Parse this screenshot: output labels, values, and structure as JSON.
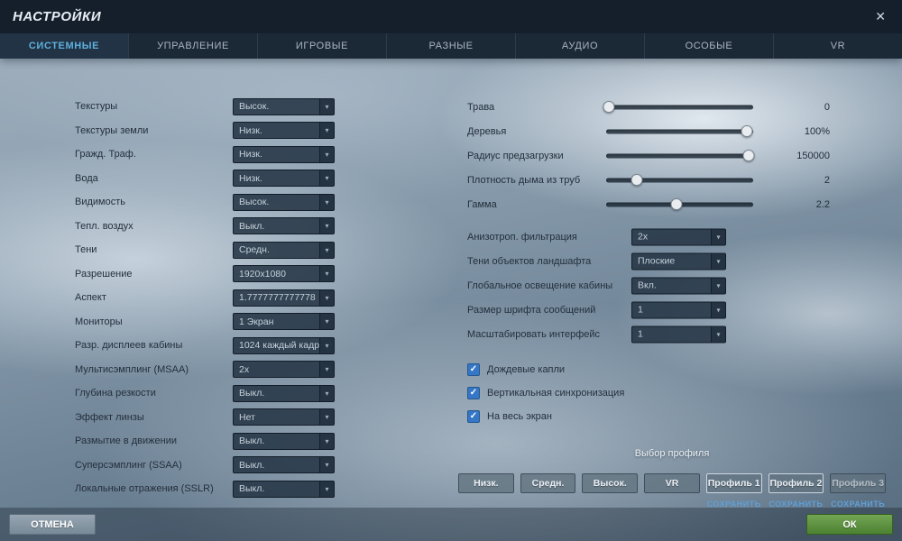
{
  "header": {
    "title": "НАСТРОЙКИ"
  },
  "icons": {
    "close": "✕",
    "chevron_down": "▾",
    "check": "✓"
  },
  "tabs": [
    {
      "label": "СИСТЕМНЫЕ",
      "cls": "active"
    },
    {
      "label": "УПРАВЛЕНИЕ",
      "cls": ""
    },
    {
      "label": "ИГРОВЫЕ",
      "cls": ""
    },
    {
      "label": "РАЗНЫЕ",
      "cls": ""
    },
    {
      "label": "АУДИО",
      "cls": ""
    },
    {
      "label": "ОСОБЫЕ",
      "cls": ""
    },
    {
      "label": "VR",
      "cls": ""
    }
  ],
  "left_settings": [
    {
      "label": "Текстуры",
      "value": "Высок."
    },
    {
      "label": "Текстуры земли",
      "value": "Низк."
    },
    {
      "label": "Гражд. Траф.",
      "value": "Низк."
    },
    {
      "label": "Вода",
      "value": "Низк."
    },
    {
      "label": "Видимость",
      "value": "Высок."
    },
    {
      "label": "Тепл. воздух",
      "value": "Выкл."
    },
    {
      "label": "Тени",
      "value": "Средн."
    },
    {
      "label": "Разрешение",
      "value": "1920x1080"
    },
    {
      "label": "Аспект",
      "value": "1.7777777777778"
    },
    {
      "label": "Мониторы",
      "value": "1 Экран"
    },
    {
      "label": "Разр. дисплеев кабины",
      "value": "1024 каждый кадр"
    },
    {
      "label": "Мультисэмплинг (MSAA)",
      "value": "2x"
    },
    {
      "label": "Глубина резкости",
      "value": "Выкл."
    },
    {
      "label": "Эффект линзы",
      "value": "Нет"
    },
    {
      "label": "Размытие в движении",
      "value": "Выкл."
    },
    {
      "label": "Суперсэмплинг (SSAA)",
      "value": "Выкл."
    },
    {
      "label": "Локальные отражения (SSLR)",
      "value": "Выкл."
    }
  ],
  "sliders": [
    {
      "label": "Трава",
      "value": "0",
      "pos": 0.02
    },
    {
      "label": "Деревья",
      "value": "100%",
      "pos": 0.96
    },
    {
      "label": "Радиус предзагрузки",
      "value": "150000",
      "pos": 0.97
    },
    {
      "label": "Плотность дыма из труб",
      "value": "2",
      "pos": 0.21
    },
    {
      "label": "Гамма",
      "value": "2.2",
      "pos": 0.48
    }
  ],
  "right_dropdowns": [
    {
      "label": "Анизотроп. фильтрация",
      "value": "2x"
    },
    {
      "label": "Тени объектов ландшафта",
      "value": "Плоские"
    },
    {
      "label": "Глобальное освещение кабины",
      "value": "Вкл."
    },
    {
      "label": "Размер шрифта сообщений",
      "value": "1"
    },
    {
      "label": "Масштабировать интерфейс",
      "value": "1"
    }
  ],
  "checkboxes": [
    {
      "label": "Дождевые капли",
      "state": "checked"
    },
    {
      "label": "Вертикальная синхронизация",
      "state": "checked"
    },
    {
      "label": "На весь экран",
      "state": "checked"
    }
  ],
  "profiles": {
    "title": "Выбор профиля",
    "buttons": [
      {
        "label": "Низк.",
        "cls": ""
      },
      {
        "label": "Средн.",
        "cls": ""
      },
      {
        "label": "Высок.",
        "cls": ""
      },
      {
        "label": "VR",
        "cls": ""
      },
      {
        "label": "Профиль 1",
        "cls": "outlined"
      },
      {
        "label": "Профиль 2",
        "cls": "outlined"
      },
      {
        "label": "Профиль 3",
        "cls": "muted"
      }
    ],
    "save_label": "СОХРАНИТЬ"
  },
  "footer": {
    "cancel": "ОТМЕНА",
    "ok": "ОК"
  }
}
